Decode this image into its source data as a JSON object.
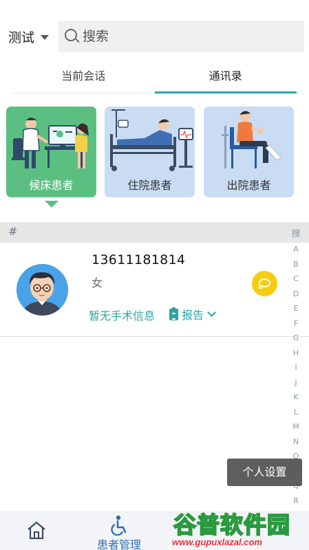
{
  "header": {
    "workspace_label": "测试",
    "search_placeholder": "搜索"
  },
  "tabs": [
    {
      "label": "当前会话",
      "active": false
    },
    {
      "label": "通讯录",
      "active": true
    }
  ],
  "categories": [
    {
      "label": "候床患者",
      "selected": true
    },
    {
      "label": "住院患者",
      "selected": false
    },
    {
      "label": "出院患者",
      "selected": false
    }
  ],
  "section_header": "#",
  "contacts": [
    {
      "phone": "13611181814",
      "gender": "女",
      "surgery_info": "暂无手术信息",
      "report_label": "报告"
    }
  ],
  "index_bar": [
    "搜",
    "A",
    "B",
    "C",
    "D",
    "E",
    "F",
    "G",
    "H",
    "I",
    "J",
    "K",
    "L",
    "M",
    "N",
    "O",
    "P",
    "Q",
    "R"
  ],
  "toast": "个人设置",
  "bottom_nav": {
    "patient_label": "患者管理"
  },
  "watermark": {
    "title": "谷普软件园",
    "url": "www.gupuxlazal.com"
  },
  "colors": {
    "accent": "#2fa3a3",
    "card_green": "#5cbf82",
    "card_blue": "#c9dcf4",
    "chat_yellow": "#f5cc12"
  }
}
